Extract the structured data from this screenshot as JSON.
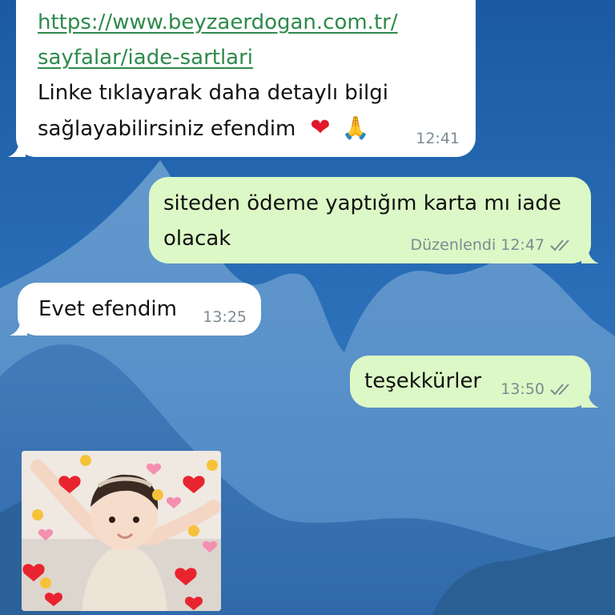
{
  "messages": [
    {
      "direction": "incoming",
      "link_line1": "https://www.beyzaerdogan.com.tr/",
      "link_line2": "sayfalar/iade-sartlari",
      "text_line1": "Linke tıklayarak daha detaylı bilgi",
      "text_line2": "sağlayabilirsiniz efendim",
      "emoji_heart": "❤",
      "emoji_pray": "🙏",
      "time": "12:41"
    },
    {
      "direction": "outgoing",
      "text_line1": "siteden ödeme yaptığım karta mı iade",
      "text_line2": "olacak",
      "edited_label": "Düzenlendi",
      "time": "12:47",
      "status": "read"
    },
    {
      "direction": "incoming",
      "text": "Evet efendim",
      "time": "13:25"
    },
    {
      "direction": "outgoing",
      "text": "teşekkürler",
      "time": "13:50",
      "status": "read"
    },
    {
      "direction": "incoming",
      "type": "sticker",
      "description_icon": "baby-with-hearts-sticker"
    }
  ],
  "colors": {
    "incoming_bubble": "#ffffff",
    "outgoing_bubble": "#dcf8c6",
    "link": "#2e8a4a",
    "meta_text": "#7d8a93",
    "wallpaper_sky": "#1f5fa6"
  }
}
